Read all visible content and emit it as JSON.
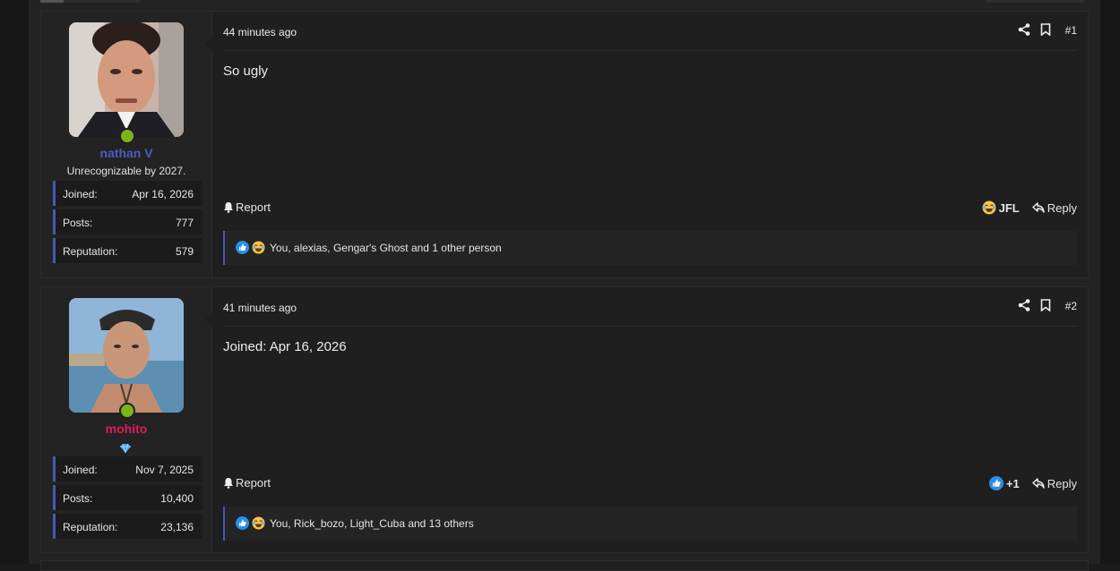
{
  "posts": [
    {
      "time": "44 minutes ago",
      "post_number": "#1",
      "message": "So ugly",
      "user": {
        "name": "nathan V",
        "title": "Unrecognizable by 2027.",
        "stats": [
          {
            "label": "Joined:",
            "value": "Apr 16, 2026"
          },
          {
            "label": "Posts:",
            "value": "777"
          },
          {
            "label": "Reputation:",
            "value": "579"
          }
        ]
      },
      "report_label": "Report",
      "reaction_summary": "JFL",
      "reply_label": "Reply",
      "reactions_text": "You, alexias, Gengar's Ghost and 1 other person"
    },
    {
      "time": "41 minutes ago",
      "post_number": "#2",
      "message": "Joined: Apr 16, 2026",
      "user": {
        "name": "mohito",
        "title": "",
        "stats": [
          {
            "label": "Joined:",
            "value": "Nov 7, 2025"
          },
          {
            "label": "Posts:",
            "value": "10,400"
          },
          {
            "label": "Reputation:",
            "value": "23,136"
          }
        ]
      },
      "report_label": "Report",
      "reaction_summary": "+1",
      "reply_label": "Reply",
      "reactions_text": "You, Rick_bozo, Light_Cuba and 13 others"
    }
  ],
  "colors": {
    "accent_blue": "#4858b0",
    "username_blue": "#4a5cc4",
    "username_pink": "#e0195c",
    "online": "#7cb518"
  }
}
